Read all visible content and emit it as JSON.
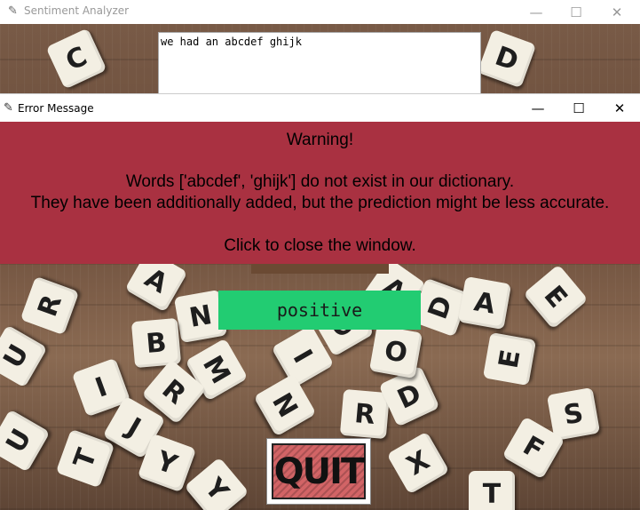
{
  "main_window": {
    "title": "Sentiment Analyzer",
    "input_text": "we had an abcdef ghijk",
    "prediction": "positive",
    "quit_label": "QUIT"
  },
  "error_window": {
    "title": "Error Message",
    "lines": [
      "Warning!",
      "Words ['abcdef', 'ghijk'] do not exist in our dictionary.",
      "They have been additionally added, but the prediction might be less accurate.",
      "Click to close the window."
    ]
  },
  "window_controls": {
    "minimize": "—",
    "maximize": "☐",
    "close": "✕"
  },
  "icons": {
    "app_icon": "feather-icon"
  },
  "colors": {
    "error_bg": "#a93141",
    "result_bg": "#22cc72",
    "quit_bg": "#d26466"
  }
}
